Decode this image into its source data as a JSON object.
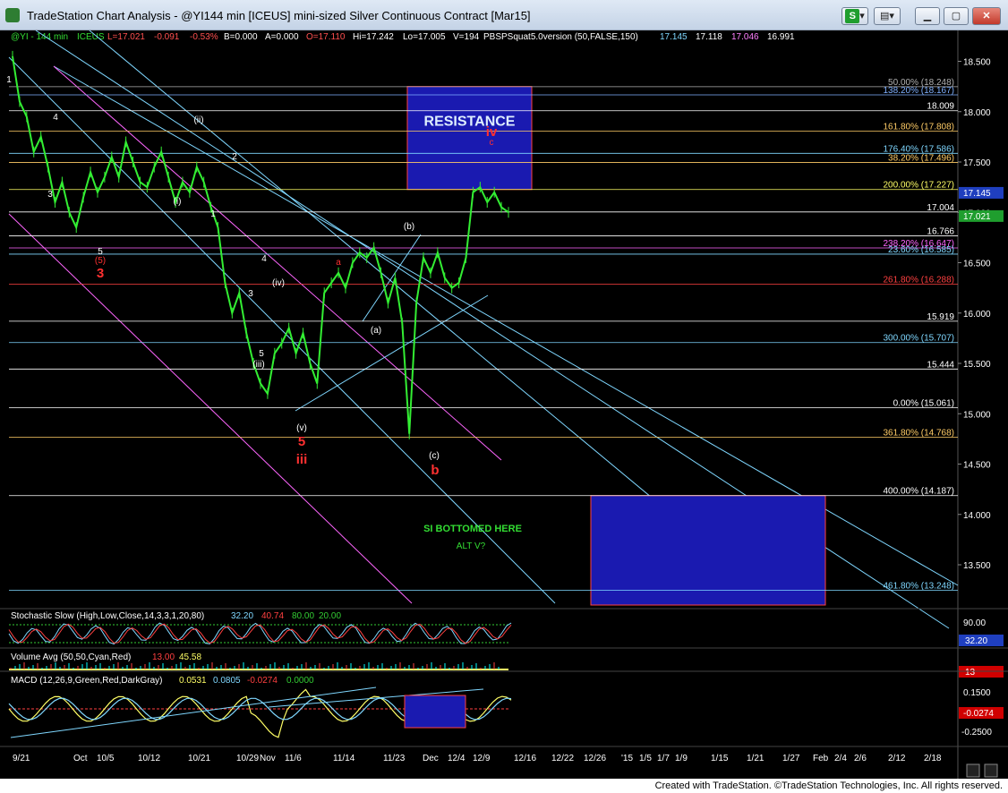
{
  "window": {
    "title": "TradeStation Chart Analysis - @YI144 min [ICEUS] mini-sized Silver Continuous Contract [Mar15]",
    "s_label": "S",
    "minimize": "▁",
    "maximize": "▢",
    "close": "✕"
  },
  "header": {
    "symbol": "@YI - 144 min",
    "exchange": "ICEUS",
    "last": "L=17.021",
    "chg": "-0.091",
    "pct": "-0.53%",
    "bid": "B=0.000",
    "ask": "A=0.000",
    "open": "O=17.110",
    "hi": "Hi=17.242",
    "lo": "Lo=17.005",
    "vol": "V=194",
    "indicator": "PBSPSquat5.0version (50,FALSE,150)",
    "ind_vals": [
      "17.145",
      "17.118",
      "17.046",
      "16.991"
    ],
    "ind_colors": [
      "#7fd7ff",
      "#ffffff",
      "#ff80ff",
      "#ffffff"
    ]
  },
  "footer": "Created with TradeStation. ©TradeStation Technologies, Inc. All rights reserved.",
  "chart_data": [
    {
      "type": "line",
      "panel": "price",
      "ylim": [
        13.1,
        18.7
      ],
      "yticks": [
        18.5,
        18.0,
        17.5,
        17.0,
        16.5,
        16.0,
        15.5,
        15.0,
        14.5,
        14.0,
        13.5
      ],
      "ytick_labels": [
        "18.500",
        "18.000",
        "17.500",
        "17.000",
        "16.500",
        "16.000",
        "15.500",
        "15.000",
        "14.500",
        "14.000",
        "13.500"
      ],
      "price_tags": [
        {
          "value": 17.145,
          "label": "17.145",
          "color": "#1f3fbf"
        },
        {
          "value": 17.021,
          "label": "17.021",
          "color": "#1f9e2e"
        }
      ],
      "x_labels": [
        "9/21",
        "Oct",
        "10/5",
        "10/12",
        "10/21",
        "10/29",
        "Nov",
        "11/6",
        "11/14",
        "11/23",
        "Dec",
        "12/4",
        "12/9",
        "12/16",
        "12/22",
        "12/26",
        "'15",
        "1/5",
        "1/7",
        "1/9",
        "1/15",
        "1/21",
        "1/27",
        "Feb",
        "2/4",
        "2/6",
        "2/12",
        "2/18"
      ],
      "series_close": [
        18.55,
        18.1,
        17.95,
        17.6,
        17.75,
        17.45,
        17.1,
        17.3,
        17.0,
        16.85,
        17.15,
        17.4,
        17.2,
        17.35,
        17.55,
        17.35,
        17.7,
        17.5,
        17.3,
        17.25,
        17.45,
        17.6,
        17.35,
        17.1,
        17.3,
        17.2,
        17.45,
        17.3,
        17.05,
        16.85,
        16.3,
        16.0,
        16.2,
        15.8,
        15.5,
        15.3,
        15.2,
        15.6,
        15.7,
        15.85,
        15.6,
        15.8,
        15.5,
        15.3,
        16.2,
        16.3,
        16.4,
        16.25,
        16.5,
        16.6,
        16.55,
        16.65,
        16.4,
        16.1,
        16.35,
        15.9,
        14.8,
        16.1,
        16.55,
        16.4,
        16.6,
        16.35,
        16.25,
        16.3,
        16.55,
        17.2,
        17.25,
        17.1,
        17.2,
        17.05,
        17.0
      ],
      "fib_levels": [
        {
          "value": 18.248,
          "label": "50.00% (18.248)",
          "color": "#b0b0b0"
        },
        {
          "value": 18.167,
          "label": "138.20% (18.167)",
          "color": "#7fb0ff"
        },
        {
          "value": 18.009,
          "label": "18.009",
          "color": "#ffffff"
        },
        {
          "value": 17.808,
          "label": "161.80% (17.808)",
          "color": "#ffcc66"
        },
        {
          "value": 17.586,
          "label": "176.40% (17.586)",
          "color": "#7fd7ff"
        },
        {
          "value": 17.496,
          "label": "38.20% (17.496)",
          "color": "#ffcc66"
        },
        {
          "value": 17.227,
          "label": "200.00% (17.227)",
          "color": "#ffff66"
        },
        {
          "value": 17.004,
          "label": "17.004",
          "color": "#ffffff"
        },
        {
          "value": 16.766,
          "label": "16.766",
          "color": "#ffffff"
        },
        {
          "value": 16.647,
          "label": "238.20% (16.647)",
          "color": "#ff66ff"
        },
        {
          "value": 16.585,
          "label": "23.60% (16.585)",
          "color": "#7fd7ff"
        },
        {
          "value": 16.288,
          "label": "261.80% (16.288)",
          "color": "#ff4040"
        },
        {
          "value": 15.919,
          "label": "15.919",
          "color": "#ffffff"
        },
        {
          "value": 15.707,
          "label": "300.00% (15.707)",
          "color": "#7fd7ff"
        },
        {
          "value": 15.444,
          "label": "15.444",
          "color": "#ffffff"
        },
        {
          "value": 15.061,
          "label": "0.00% (15.061)",
          "color": "#ffffff"
        },
        {
          "value": 14.768,
          "label": "361.80% (14.768)",
          "color": "#ffcc66"
        },
        {
          "value": 14.187,
          "label": "400.00% (14.187)",
          "color": "#ffffff"
        },
        {
          "value": 13.248,
          "label": "461.80% (13.248)",
          "color": "#7fd7ff"
        }
      ],
      "boxes": [
        {
          "name": "resistance-box",
          "x_from": "11/25",
          "x_to": "12/10",
          "y_from": 17.227,
          "y_to": 18.25,
          "label": "RESISTANCE"
        },
        {
          "name": "target-box",
          "x_from": "12/26",
          "x_to": "Feb",
          "y_from": 13.1,
          "y_to": 14.187,
          "label": ""
        }
      ],
      "annotations": [
        {
          "text": "1",
          "color": "#ffffff"
        },
        {
          "text": "4",
          "color": "#ffffff"
        },
        {
          "text": "3",
          "color": "#ffffff"
        },
        {
          "text": "5",
          "color": "#ffffff"
        },
        {
          "text": "(5)",
          "color": "#ff3030"
        },
        {
          "text": "3",
          "color": "#ff3030"
        },
        {
          "text": "(i)",
          "color": "#ffffff"
        },
        {
          "text": "(ii)",
          "color": "#ffffff"
        },
        {
          "text": "1",
          "color": "#ffffff"
        },
        {
          "text": "2",
          "color": "#ffffff"
        },
        {
          "text": "4",
          "color": "#ffffff"
        },
        {
          "text": "3",
          "color": "#ffffff"
        },
        {
          "text": "(iv)",
          "color": "#ffffff"
        },
        {
          "text": "5",
          "color": "#ffffff"
        },
        {
          "text": "(iii)",
          "color": "#ffffff"
        },
        {
          "text": "(v)",
          "color": "#ffffff"
        },
        {
          "text": "5",
          "color": "#ff3030"
        },
        {
          "text": "iii",
          "color": "#ff3030"
        },
        {
          "text": "a",
          "color": "#ff3030"
        },
        {
          "text": "(a)",
          "color": "#ffffff"
        },
        {
          "text": "(b)",
          "color": "#ffffff"
        },
        {
          "text": "(c)",
          "color": "#ffffff"
        },
        {
          "text": "b",
          "color": "#ff3030"
        },
        {
          "text": "iv",
          "color": "#ff3030"
        },
        {
          "text": "c",
          "color": "#ff3030"
        },
        {
          "text": "SI BOTTOMED HERE",
          "color": "#33dd33"
        },
        {
          "text": "ALT V?",
          "color": "#33dd33"
        }
      ]
    },
    {
      "type": "line",
      "panel": "stochastic",
      "title": "Stochastic Slow (High,Low,Close,14,3,3,1,20,80)",
      "values": [
        "32.20",
        "40.74",
        "80.00",
        "20.00"
      ],
      "value_colors": [
        "#7fd7ff",
        "#ff4040",
        "#33cc33",
        "#33cc33"
      ],
      "ylim": [
        0,
        100
      ],
      "ytick_labels": [
        "90.00"
      ],
      "tag": "32.20"
    },
    {
      "type": "bar",
      "panel": "volume",
      "title": "Volume Avg (50,50,Cyan,Red)",
      "values": [
        "13.00",
        "45.58"
      ],
      "value_colors": [
        "#ff4040",
        "#ffff66"
      ],
      "tag": "13"
    },
    {
      "type": "line",
      "panel": "macd",
      "title": "MACD (12,26,9,Green,Red,DarkGray)",
      "values": [
        "0.0531",
        "0.0805",
        "-0.0274",
        "0.0000"
      ],
      "value_colors": [
        "#ffff66",
        "#7fd7ff",
        "#ff4040",
        "#33cc33"
      ],
      "ytick_labels": [
        "0.1500",
        "-0.2500"
      ],
      "tags": [
        "",
        "-0.0274"
      ]
    }
  ]
}
